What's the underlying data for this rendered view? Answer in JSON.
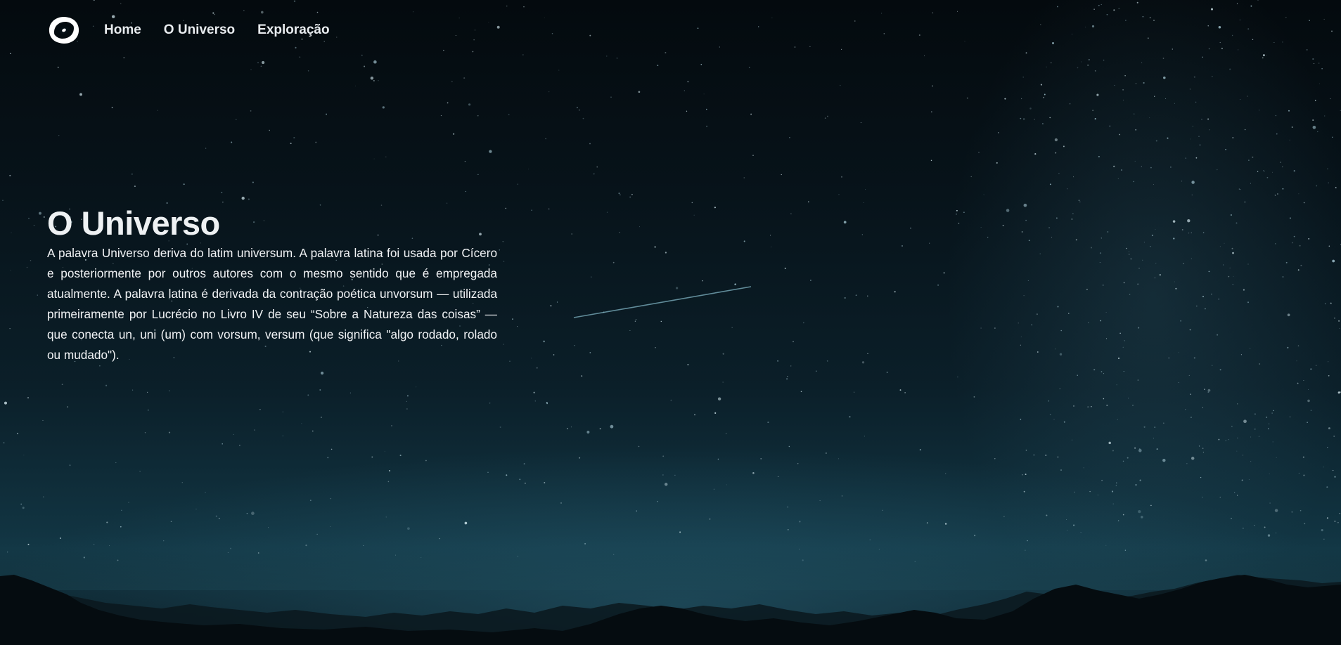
{
  "nav": {
    "logo_icon": "galaxy-swirl-logo-icon",
    "links": [
      {
        "label": "Home"
      },
      {
        "label": "O Universo"
      },
      {
        "label": "Exploração"
      }
    ]
  },
  "hero": {
    "title": "O Universo",
    "text": "A palavra Universo deriva do latim universum. A palavra latina foi usada por Cícero e posteriormente por outros autores com o mesmo sentido que é empregada atualmente. A palavra latina é derivada da contração poética unvorsum — utilizada primeiramente por Lucrécio no Livro IV de seu “Sobre a Natureza das coisas” — que conecta un, uni (um) com vorsum, versum (que significa \"algo rodado, rolado ou mudado\")."
  },
  "colors": {
    "background": "#061016",
    "horizon_glow": "#123644",
    "text": "#ffffff",
    "nav_text": "#e8ecef"
  }
}
